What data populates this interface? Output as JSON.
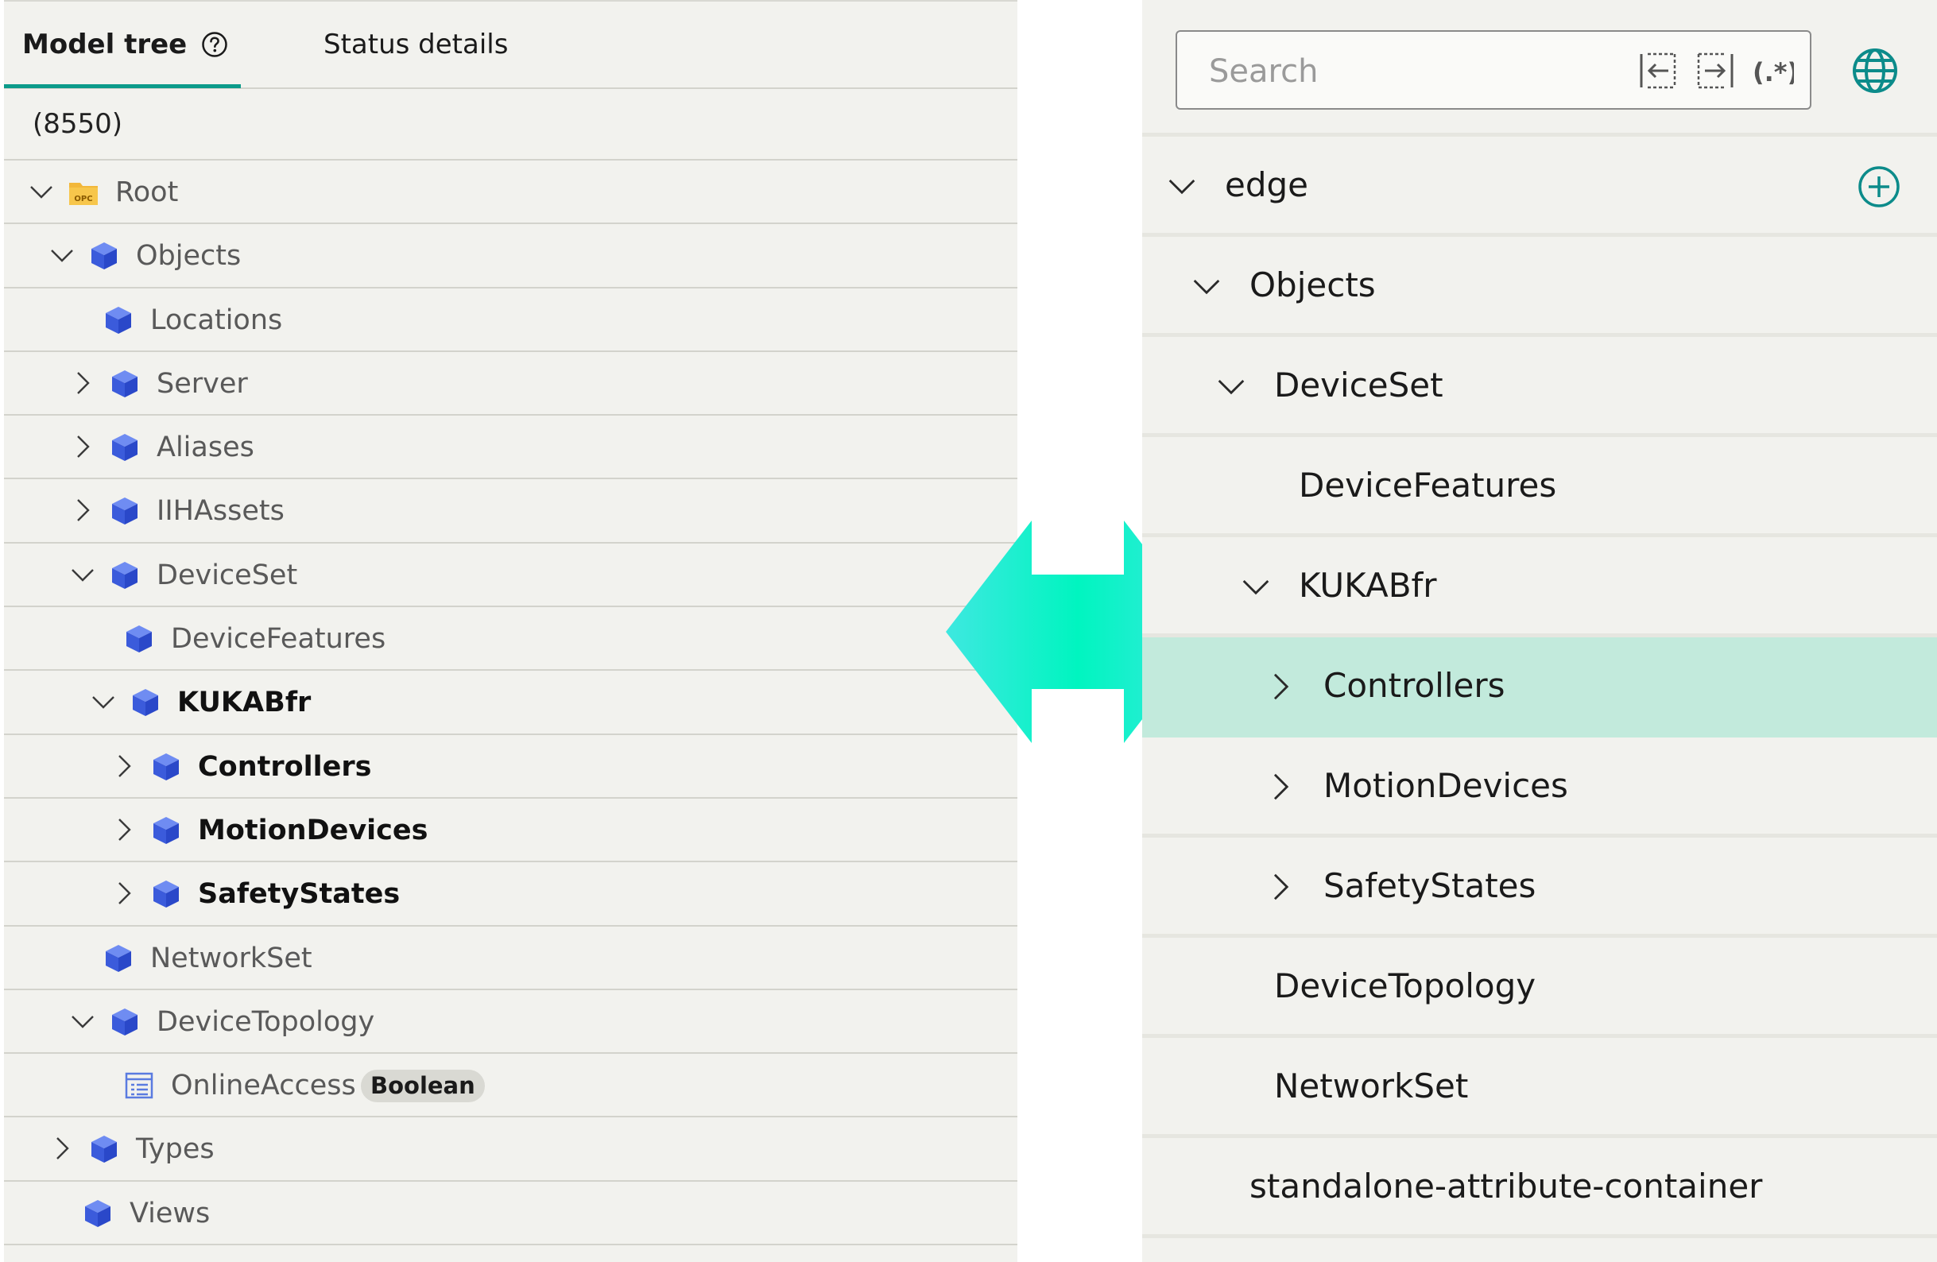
{
  "left_panel": {
    "tabs": {
      "model_tree": "Model tree",
      "status_details": "Status details"
    },
    "count": "(8550)",
    "tree": [
      {
        "label": "Root",
        "indent": 0,
        "expander": "down",
        "icon": "opc-icon",
        "bold": false
      },
      {
        "label": "Objects",
        "indent": 1,
        "expander": "down",
        "icon": "cube-icon",
        "bold": false
      },
      {
        "label": "Locations",
        "indent": 2,
        "expander": "none",
        "icon": "cube-icon",
        "bold": false
      },
      {
        "label": "Server",
        "indent": 2,
        "expander": "right",
        "icon": "cube-icon",
        "bold": false
      },
      {
        "label": "Aliases",
        "indent": 2,
        "expander": "right",
        "icon": "cube-icon",
        "bold": false
      },
      {
        "label": "IIHAssets",
        "indent": 2,
        "expander": "right",
        "icon": "cube-icon",
        "bold": false
      },
      {
        "label": "DeviceSet",
        "indent": 2,
        "expander": "down",
        "icon": "cube-icon",
        "bold": false
      },
      {
        "label": "DeviceFeatures",
        "indent": 3,
        "expander": "none",
        "icon": "cube-icon",
        "bold": false
      },
      {
        "label": "KUKABfr",
        "indent": 3,
        "expander": "down",
        "icon": "cube-icon",
        "bold": true
      },
      {
        "label": "Controllers",
        "indent": 4,
        "expander": "right",
        "icon": "cube-icon",
        "bold": true
      },
      {
        "label": "MotionDevices",
        "indent": 4,
        "expander": "right",
        "icon": "cube-icon",
        "bold": true
      },
      {
        "label": "SafetyStates",
        "indent": 4,
        "expander": "right",
        "icon": "cube-icon",
        "bold": true
      },
      {
        "label": "NetworkSet",
        "indent": 2,
        "expander": "none",
        "icon": "cube-icon",
        "bold": false
      },
      {
        "label": "DeviceTopology",
        "indent": 2,
        "expander": "down",
        "icon": "cube-icon",
        "bold": false
      },
      {
        "label": "OnlineAccess",
        "indent": 3,
        "expander": "none",
        "icon": "variable-icon",
        "bold": false,
        "badge": "Boolean"
      },
      {
        "label": "Types",
        "indent": 1,
        "expander": "right",
        "icon": "cube-icon",
        "bold": false
      },
      {
        "label": "Views",
        "indent": 1,
        "expander": "none",
        "icon": "cube-icon",
        "bold": false
      }
    ]
  },
  "right_panel": {
    "search": {
      "placeholder": "Search",
      "value": ""
    },
    "tree": [
      {
        "label": "edge",
        "indent": 0,
        "expander": "down",
        "add": true
      },
      {
        "label": "Objects",
        "indent": 1,
        "expander": "down"
      },
      {
        "label": "DeviceSet",
        "indent": 2,
        "expander": "down"
      },
      {
        "label": "DeviceFeatures",
        "indent": 3,
        "expander": "none"
      },
      {
        "label": "KUKABfr",
        "indent": 3,
        "expander": "down"
      },
      {
        "label": "Controllers",
        "indent": 4,
        "expander": "right",
        "selected": true
      },
      {
        "label": "MotionDevices",
        "indent": 4,
        "expander": "right"
      },
      {
        "label": "SafetyStates",
        "indent": 4,
        "expander": "right"
      },
      {
        "label": "DeviceTopology",
        "indent": 2,
        "expander": "none"
      },
      {
        "label": "NetworkSet",
        "indent": 2,
        "expander": "none"
      },
      {
        "label": "standalone-attribute-container",
        "indent": 1,
        "expander": "none"
      }
    ]
  },
  "colors": {
    "accent": "#0c9b8a",
    "selected_row": "#c2eadc",
    "cube": "#3b5bdb",
    "arrow_a": "#3df0d6",
    "arrow_b": "#00f2c0"
  }
}
